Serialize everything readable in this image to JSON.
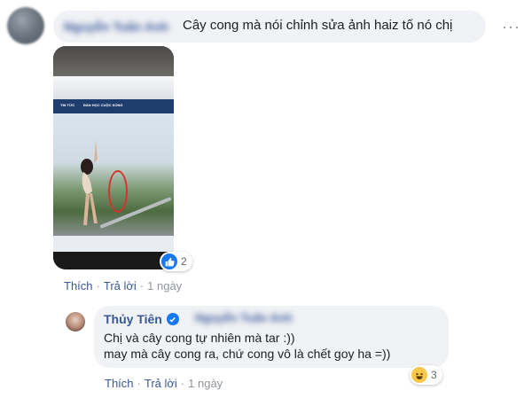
{
  "comment": {
    "author_blurred": "Nguyễn Tuấn Anh",
    "text": "Cây cong mà nói chỉnh sửa ảnh haiz tố nó chị",
    "more_icon": "more-dots-icon",
    "photo_nav": [
      "TIN TỨC",
      "ĐÀN HỌC CUỘC SỐNG"
    ],
    "reaction": {
      "icon": "like-icon",
      "count": "2",
      "color": "#1877f2"
    },
    "actions": {
      "like": "Thích",
      "reply": "Trả lời",
      "time": "1 ngày"
    }
  },
  "reply": {
    "author": "Thủy Tiên",
    "verified_icon": "verified-badge-icon",
    "tagged_blurred": "Nguyễn Tuấn Anh",
    "lines": [
      "Chị và cây cong tự nhiên mà tar :))",
      "may mà cây cong ra, chứ cong vô là chết goy ha =))"
    ],
    "reaction": {
      "icon": "haha-icon",
      "count": "3",
      "color": "#f7c74a"
    },
    "actions": {
      "like": "Thích",
      "reply": "Trả lời",
      "time": "1 ngày"
    }
  },
  "colors": {
    "link": "#385898",
    "bubble": "#f0f2f5",
    "meta": "#90949c"
  }
}
